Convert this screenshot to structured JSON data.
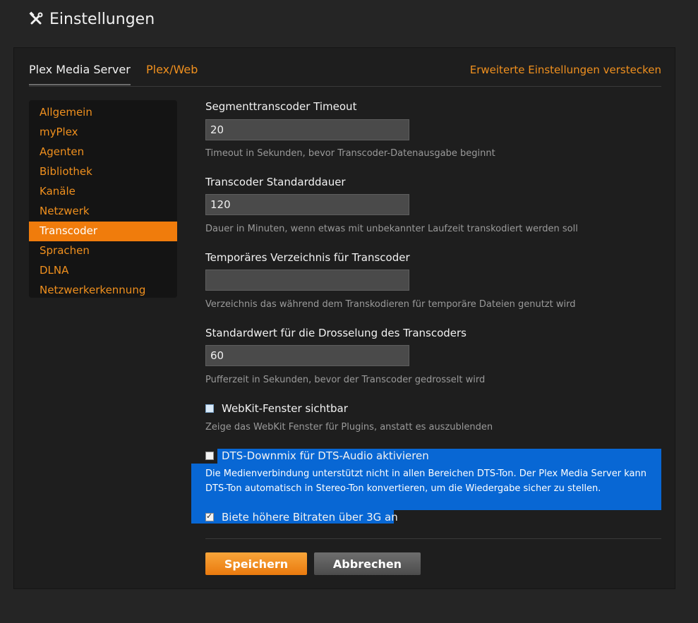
{
  "header": {
    "title": "Einstellungen",
    "icon": "tools-icon"
  },
  "tabs": {
    "server": "Plex Media Server",
    "web": "Plex/Web",
    "advanced": "Erweiterte Einstellungen verstecken"
  },
  "sidebar": {
    "selected": "Transcoder",
    "items": [
      {
        "label": "Allgemein"
      },
      {
        "label": "myPlex"
      },
      {
        "label": "Agenten"
      },
      {
        "label": "Bibliothek"
      },
      {
        "label": "Kanäle"
      },
      {
        "label": "Netzwerk"
      },
      {
        "label": "Transcoder"
      },
      {
        "label": "Sprachen"
      },
      {
        "label": "DLNA"
      },
      {
        "label": "Netzwerkerkennung"
      }
    ]
  },
  "settings": {
    "timeout": {
      "label": "Segmenttranscoder Timeout",
      "value": "20",
      "help": "Timeout in Sekunden, bevor Transcoder-Datenausgabe beginnt"
    },
    "duration": {
      "label": "Transcoder Standarddauer",
      "value": "120",
      "help": "Dauer in Minuten, wenn etwas mit unbekannter Laufzeit transkodiert werden soll"
    },
    "tempdir": {
      "label": "Temporäres Verzeichnis für Transcoder",
      "value": "",
      "help": "Verzeichnis das während dem Transkodieren für temporäre Dateien genutzt wird"
    },
    "throttle": {
      "label": "Standardwert für die Drosselung des Transcoders",
      "value": "60",
      "help": "Pufferzeit in Sekunden, bevor der Transcoder gedrosselt wird"
    },
    "webkit": {
      "label": "WebKit-Fenster sichtbar",
      "checked": false,
      "help": "Zeige das WebKit Fenster für Plugins, anstatt es auszublenden"
    },
    "dts": {
      "label": "DTS-Downmix für DTS-Audio aktivieren",
      "checked": false,
      "help_line1": "Die Medienverbindung unterstützt nicht in allen Bereichen DTS-Ton. Der Plex Media Server kann",
      "help_line2": "DTS-Ton automatisch in Stereo-Ton konvertieren, um die Wiedergabe sicher zu stellen."
    },
    "bitrate3g": {
      "label": "Biete höhere Bitraten über 3G an",
      "checked": true
    }
  },
  "buttons": {
    "save": "Speichern",
    "cancel": "Abbrechen"
  },
  "colors": {
    "accent": "#f0901e",
    "selected_nav": "#f07c0c",
    "selection_highlight": "#0867d4"
  }
}
